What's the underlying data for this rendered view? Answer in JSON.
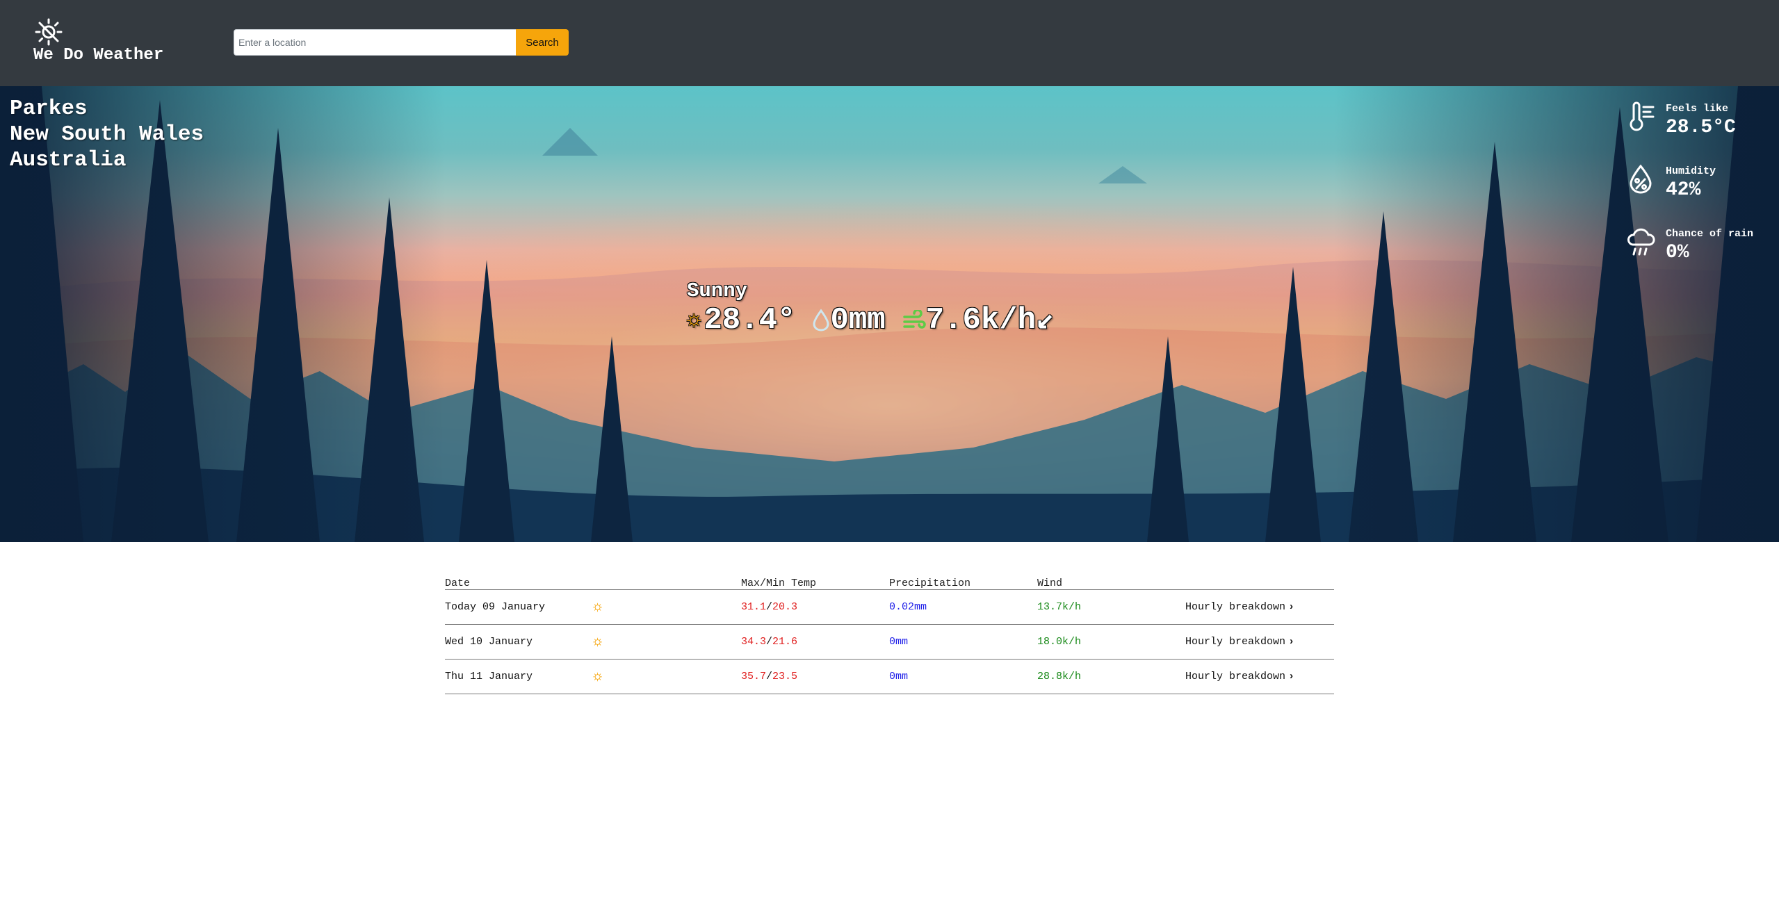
{
  "brand": {
    "name": "We Do Weather",
    "logo_icon": "sun-gear-icon"
  },
  "search": {
    "placeholder": "Enter a location",
    "value": "",
    "button_label": "Search"
  },
  "location": {
    "city": "Parkes",
    "state": "New South Wales",
    "country": "Australia"
  },
  "current": {
    "condition": "Sunny",
    "temperature": "28.4°",
    "precipitation": "0mm",
    "wind": "7.6k/h",
    "wind_direction_arrow": "↙",
    "icons": {
      "condition": "sun-icon",
      "precipitation": "droplet-icon",
      "wind": "wind-icon"
    }
  },
  "stats": [
    {
      "label": "Feels like",
      "value": "28.5°C",
      "icon": "thermometer-icon"
    },
    {
      "label": "Humidity",
      "value": "42%",
      "icon": "humidity-drop-icon"
    },
    {
      "label": "Chance of rain",
      "value": "0%",
      "icon": "rain-cloud-icon"
    }
  ],
  "forecast": {
    "headers": {
      "date": "Date",
      "icon": "",
      "temp": "Max/Min Temp",
      "precipitation": "Precipitation",
      "wind": "Wind",
      "link": ""
    },
    "rows": [
      {
        "date": "Today 09 January",
        "icon": "sun-icon",
        "max": "31.1",
        "min": "20.3",
        "precipitation": "0.02mm",
        "wind": "13.7k/h",
        "link": "Hourly breakdown"
      },
      {
        "date": "Wed 10 January",
        "icon": "sun-icon",
        "max": "34.3",
        "min": "21.6",
        "precipitation": "0mm",
        "wind": "18.0k/h",
        "link": "Hourly breakdown"
      },
      {
        "date": "Thu 11 January",
        "icon": "sun-icon",
        "max": "35.7",
        "min": "23.5",
        "precipitation": "0mm",
        "wind": "28.8k/h",
        "link": "Hourly breakdown"
      }
    ]
  },
  "colors": {
    "navbar": "#343a40",
    "search_button": "#f6a50b",
    "temp": "#e01e1e",
    "precipitation": "#1e1ee8",
    "wind": "#1a8a1a"
  }
}
